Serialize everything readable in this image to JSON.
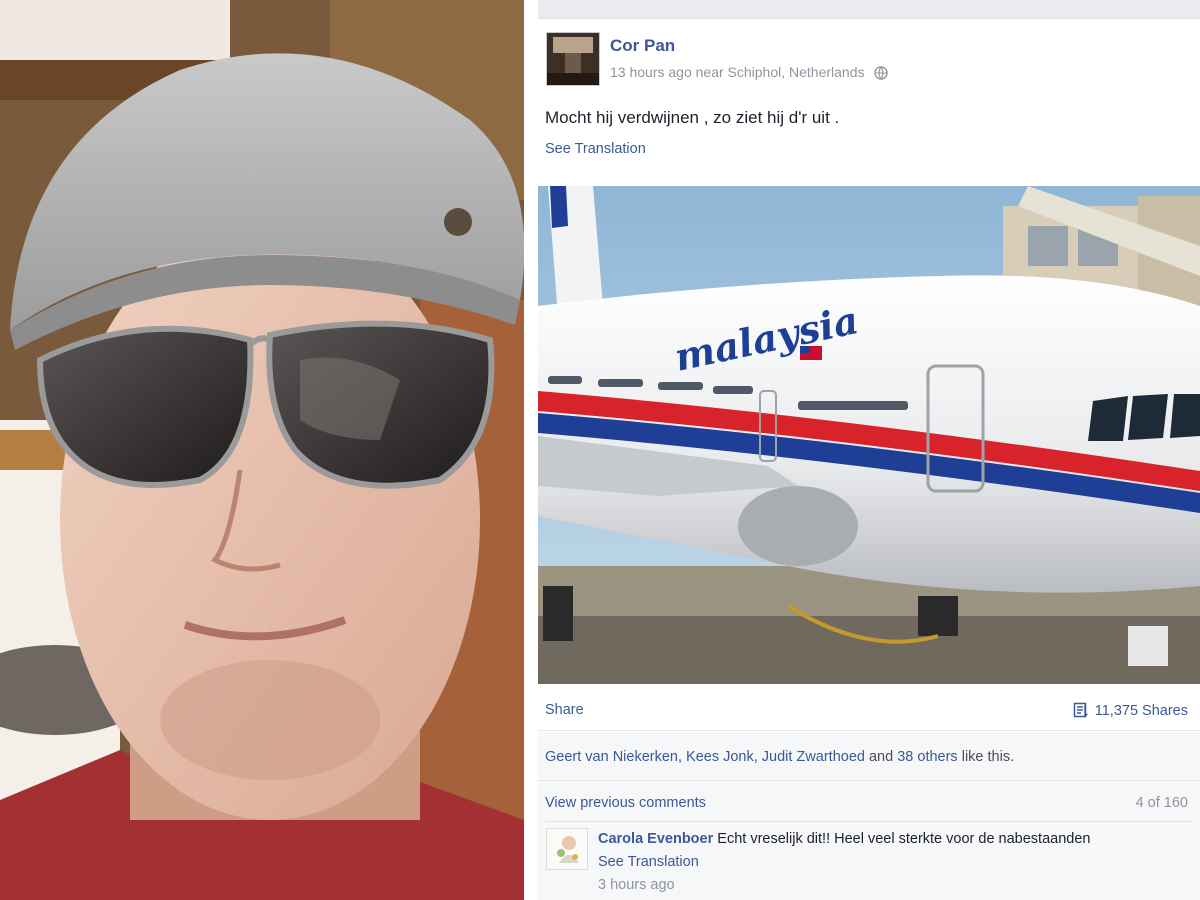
{
  "post": {
    "author": "Cor Pan",
    "time": "13 hours ago",
    "location": "near Schiphol, Netherlands",
    "audience_icon": "globe-icon",
    "text": "Mocht hij verdwijnen , zo ziet hij d'r uit .",
    "see_translation": "See Translation",
    "photo_airline_text": "malaysia"
  },
  "actions": {
    "share_label": "Share",
    "shares_count": "11,375 Shares",
    "shares_icon": "share-count-icon"
  },
  "likes": {
    "names": "Geert van Niekerken, Kees Jonk, Judit Zwarthoed",
    "connector": " and ",
    "others": "38 others",
    "suffix": " like this."
  },
  "comments": {
    "view_previous": "View previous comments",
    "count": "4 of 160",
    "items": [
      {
        "author": "Carola Evenboer",
        "text": "Echt vreselijk dit!! Heel veel sterkte voor de nabestaanden",
        "see_translation": "See Translation",
        "time": "3 hours ago"
      }
    ]
  },
  "colors": {
    "link_blue": "#3b5998",
    "meta_gray": "#90949c",
    "plane_red": "#d8232a",
    "plane_blue": "#1f3f96"
  }
}
